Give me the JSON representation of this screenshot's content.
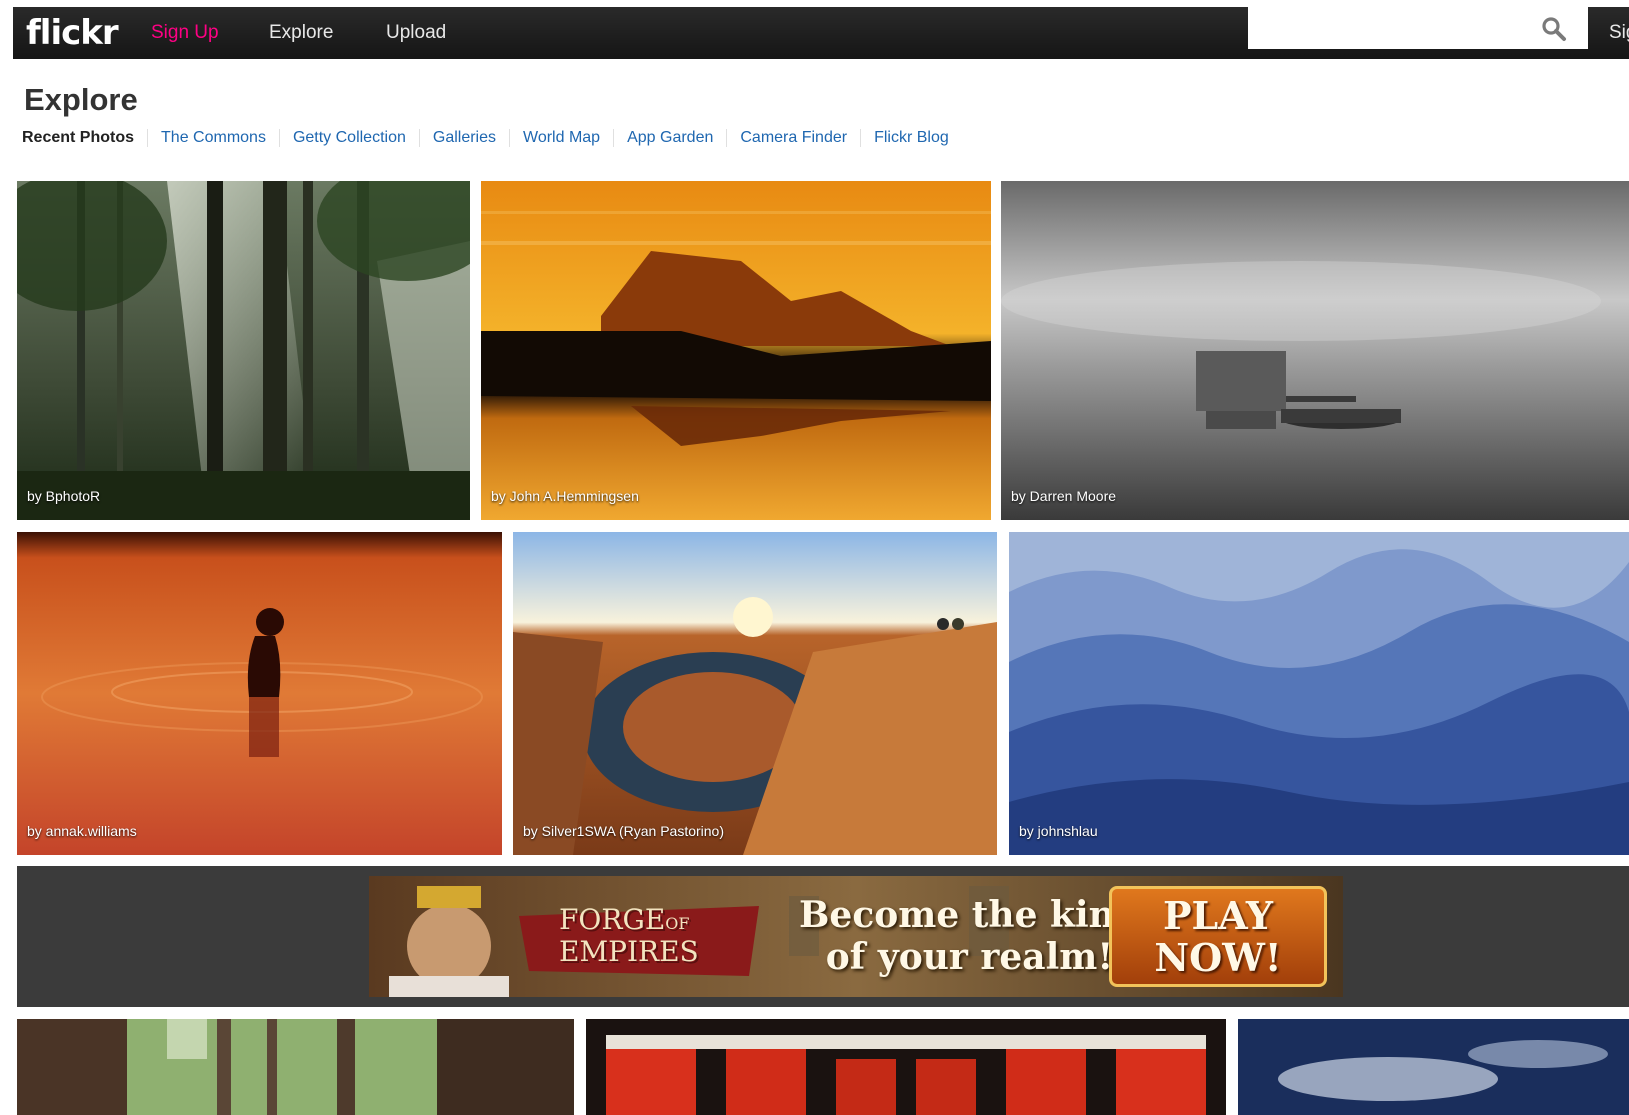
{
  "header": {
    "logo": "flickr",
    "nav": {
      "signup": "Sign Up",
      "explore": "Explore",
      "upload": "Upload"
    },
    "search": {
      "placeholder": "",
      "value": ""
    },
    "signin": "Sig"
  },
  "page": {
    "title": "Explore",
    "subnav": [
      "Recent Photos",
      "The Commons",
      "Getty Collection",
      "Galleries",
      "World Map",
      "App Garden",
      "Camera Finder",
      "Flickr Blog"
    ]
  },
  "photos": {
    "row1": [
      {
        "caption": "by BphotoR"
      },
      {
        "caption": "by John A.Hemmingsen"
      },
      {
        "caption": "by Darren Moore"
      }
    ],
    "row2": [
      {
        "caption": "by annak.williams"
      },
      {
        "caption": "by Silver1SWA (Ryan Pastorino)"
      },
      {
        "caption": "by johnshlau"
      }
    ]
  },
  "ad": {
    "logo_line1": "FORGE",
    "logo_of": "OF",
    "logo_line2": "EMPIRES",
    "tagline_line1": "Become the king",
    "tagline_line2": "of your realm!",
    "cta_line1": "PLAY",
    "cta_line2": "NOW!"
  },
  "colors": {
    "accent_signup": "#ff0084",
    "link": "#1f67b0",
    "topbar": "#1a1a1a"
  }
}
